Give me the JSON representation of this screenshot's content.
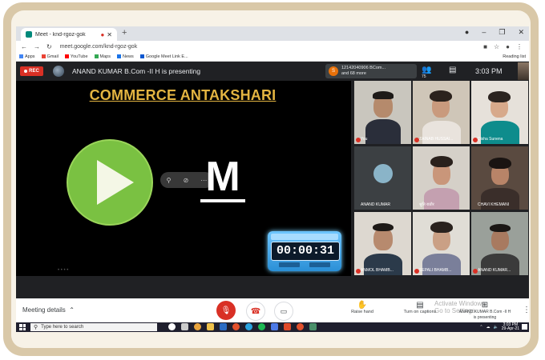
{
  "browser": {
    "tab_title": "Meet - knd-rgoz-gok",
    "url": "meet.google.com/knd-rgoz-gok",
    "bookmarks": [
      "Apps",
      "Gmail",
      "YouTube",
      "Maps",
      "News",
      "Google Meet Link E..."
    ],
    "reading_list": "Reading list"
  },
  "meet": {
    "rec_label": "REC",
    "presenting_text": "ANAND KUMAR B.Com -II H is presenting",
    "participants_line1": "12142040906 BCom...",
    "participants_line2": "and 68 more",
    "people_count": "75",
    "clock": "3:03 PM",
    "self_label": "You"
  },
  "presentation": {
    "title": "COMMERCE ANTAKSHARI",
    "letter": "M",
    "timer": "00:00:31"
  },
  "tiles": [
    {
      "name": "You"
    },
    {
      "name": "ZAINAB HUSSAI..."
    },
    {
      "name": "Disha Sunena"
    },
    {
      "name": "ANAND KUMAR"
    },
    {
      "name": "श्रुति राठौर"
    },
    {
      "name": "CHAVI KHEMANI"
    },
    {
      "name": "ANMOL BHAMB..."
    },
    {
      "name": "SEPALI BHAMB..."
    },
    {
      "name": "ANAND KUMAR..."
    }
  ],
  "bottom_bar": {
    "meeting_details": "Meeting details",
    "raise_hand": "Raise hand",
    "captions": "Turn on captions",
    "presenting_line1": "ANAND KUMAR B.Com -II H",
    "presenting_line2": "is presenting",
    "activate_line1": "Activate Windows",
    "activate_line2": "Go to Settings"
  },
  "taskbar": {
    "search_placeholder": "Type here to search",
    "time": "3:03 PM",
    "date": "29-Apr-21"
  },
  "colors": {
    "title_gold": "#e3b441",
    "rec_red": "#d93025",
    "play_green": "#7ac142",
    "meet_bg": "#202124"
  }
}
